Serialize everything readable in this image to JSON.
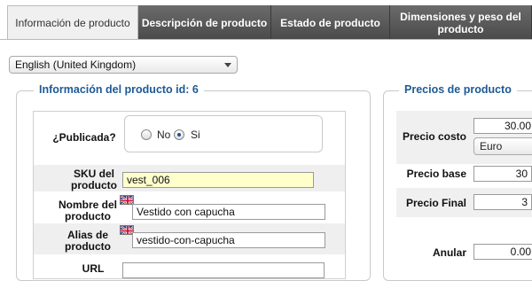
{
  "tabs": [
    {
      "label": "Información de producto",
      "active": true
    },
    {
      "label": "Descripción de producto",
      "active": false
    },
    {
      "label": "Estado de producto",
      "active": false
    },
    {
      "label": "Dimensiones y peso del producto",
      "active": false
    }
  ],
  "language_select": {
    "value": "English (United Kingdom)"
  },
  "product_info": {
    "legend": "Información del producto id: 6",
    "published_label": "¿Publicada?",
    "published_options": [
      {
        "label": "No",
        "checked": false
      },
      {
        "label": "Si",
        "checked": true
      }
    ],
    "sku_label": "SKU del producto",
    "sku_value": "vest_006",
    "name_label": "Nombre del producto",
    "name_value": "Vestido con capucha",
    "alias_label": "Alias de producto",
    "alias_value": "vestido-con-capucha",
    "url_label": "URL"
  },
  "prices": {
    "legend": "Precios de producto",
    "cost_label": "Precio costo",
    "cost_value": "30.00",
    "currency": "Euro",
    "base_label": "Precio base",
    "base_value": "30",
    "final_label": "Precio Final",
    "final_value": "3",
    "override_label": "Anular",
    "override_value": "0.00"
  },
  "colors": {
    "legend_blue": "#1d5a96",
    "tab_dark": "#555555",
    "sku_bg": "#ffffcc"
  }
}
